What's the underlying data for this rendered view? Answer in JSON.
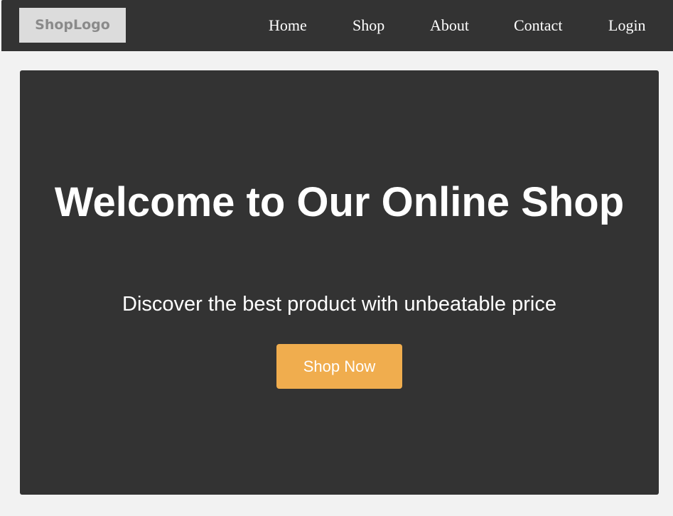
{
  "header": {
    "logo": "ShopLogo",
    "nav": {
      "home": "Home",
      "shop": "Shop",
      "about": "About",
      "contact": "Contact",
      "login": "Login"
    }
  },
  "hero": {
    "title": "Welcome to Our Online Shop",
    "subtitle": "Discover the best product with unbeatable price",
    "cta_label": "Shop Now"
  },
  "colors": {
    "nav_background": "#333333",
    "page_background": "#f2f2f2",
    "hero_background": "#333333",
    "logo_background": "#dcdcdc",
    "accent": "#f0ad4e"
  }
}
